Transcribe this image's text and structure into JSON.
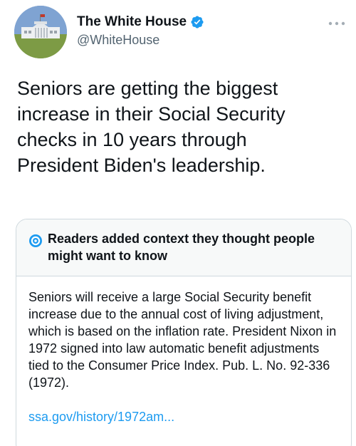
{
  "author": {
    "name": "The White House",
    "handle": "@WhiteHouse"
  },
  "tweet": {
    "text": "Seniors are getting the biggest increase in their Social Security checks in 10 years through President Biden's leadership."
  },
  "context_note": {
    "title": "Readers added context they thought people might want to know",
    "body": "Seniors will receive a large Social Security benefit increase due to the annual cost of living adjustment, which is based on the inflation rate. President Nixon in 1972 signed into law automatic benefit adjustments tied to the Consumer Price Index. Pub. L. No. 92-336 (1972).",
    "link_text": "ssa.gov/history/1972am..."
  },
  "icons": {
    "avatar": "white-house-avatar",
    "verified": "verified-badge-icon",
    "more": "more-options-icon",
    "context": "community-notes-icon"
  },
  "colors": {
    "verified": "#1d9bf0",
    "link": "#1d9bf0",
    "handle": "#536471",
    "context_header_bg": "#f7f9f9"
  }
}
